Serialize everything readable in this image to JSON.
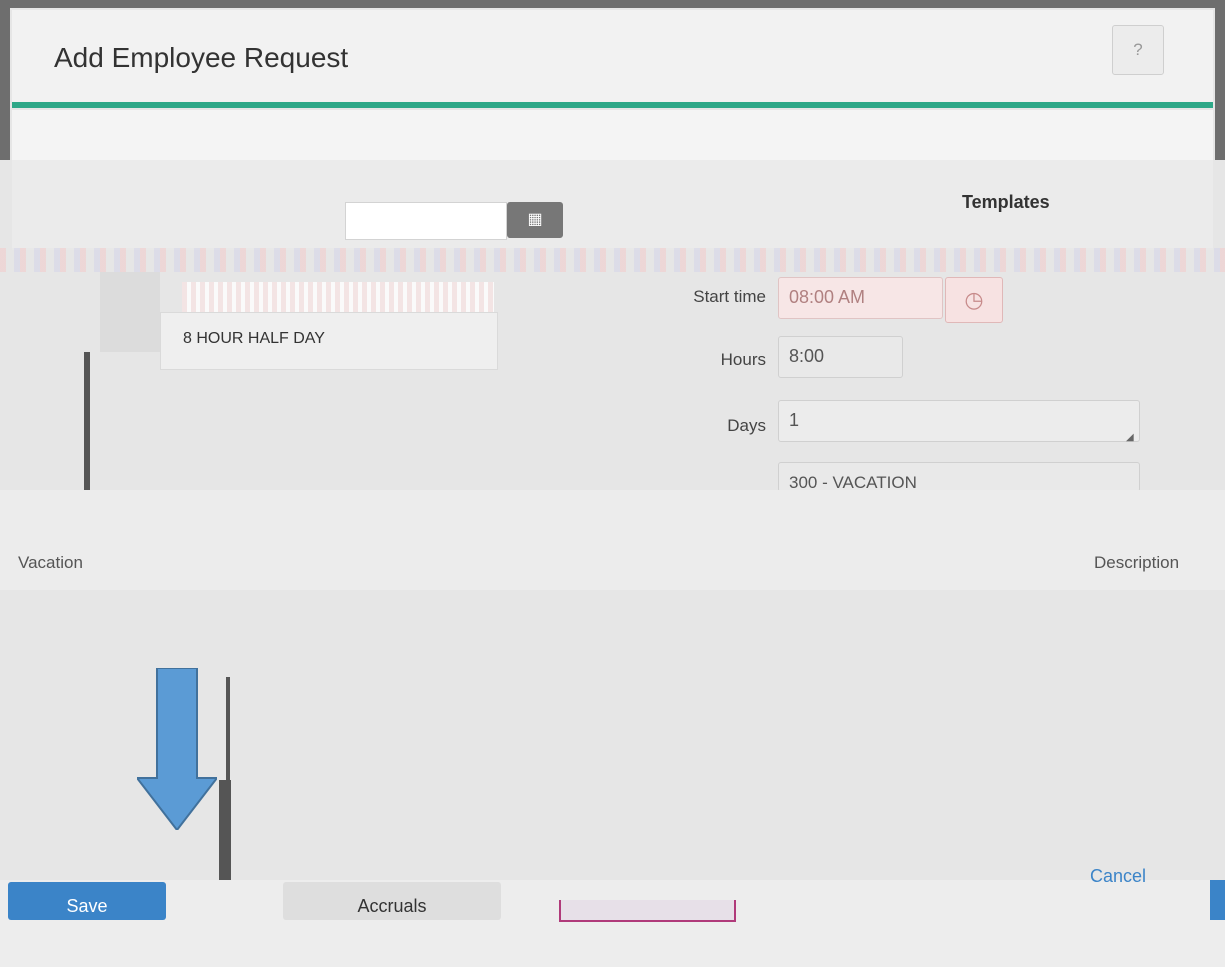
{
  "dialog": {
    "title": "Add Employee Request",
    "help_label": "?"
  },
  "templates": {
    "label": "Templates",
    "items": [
      "8 HOUR HALF DAY"
    ]
  },
  "form": {
    "start_time_label": "Start time",
    "start_time_value": "08:00 AM",
    "hours_label": "Hours",
    "hours_value": "8:00",
    "days_label": "Days",
    "days_value": "1",
    "pay_code_partial": "300 - VACATION"
  },
  "request": {
    "type_label": "Vacation",
    "description_label": "Description"
  },
  "footer": {
    "save_label": "Save",
    "accruals_label": "Accruals",
    "cancel_label": "Cancel"
  },
  "colors": {
    "accent": "#2ea888",
    "primary_button": "#3b84c8",
    "arrow": "#5b9bd5"
  }
}
